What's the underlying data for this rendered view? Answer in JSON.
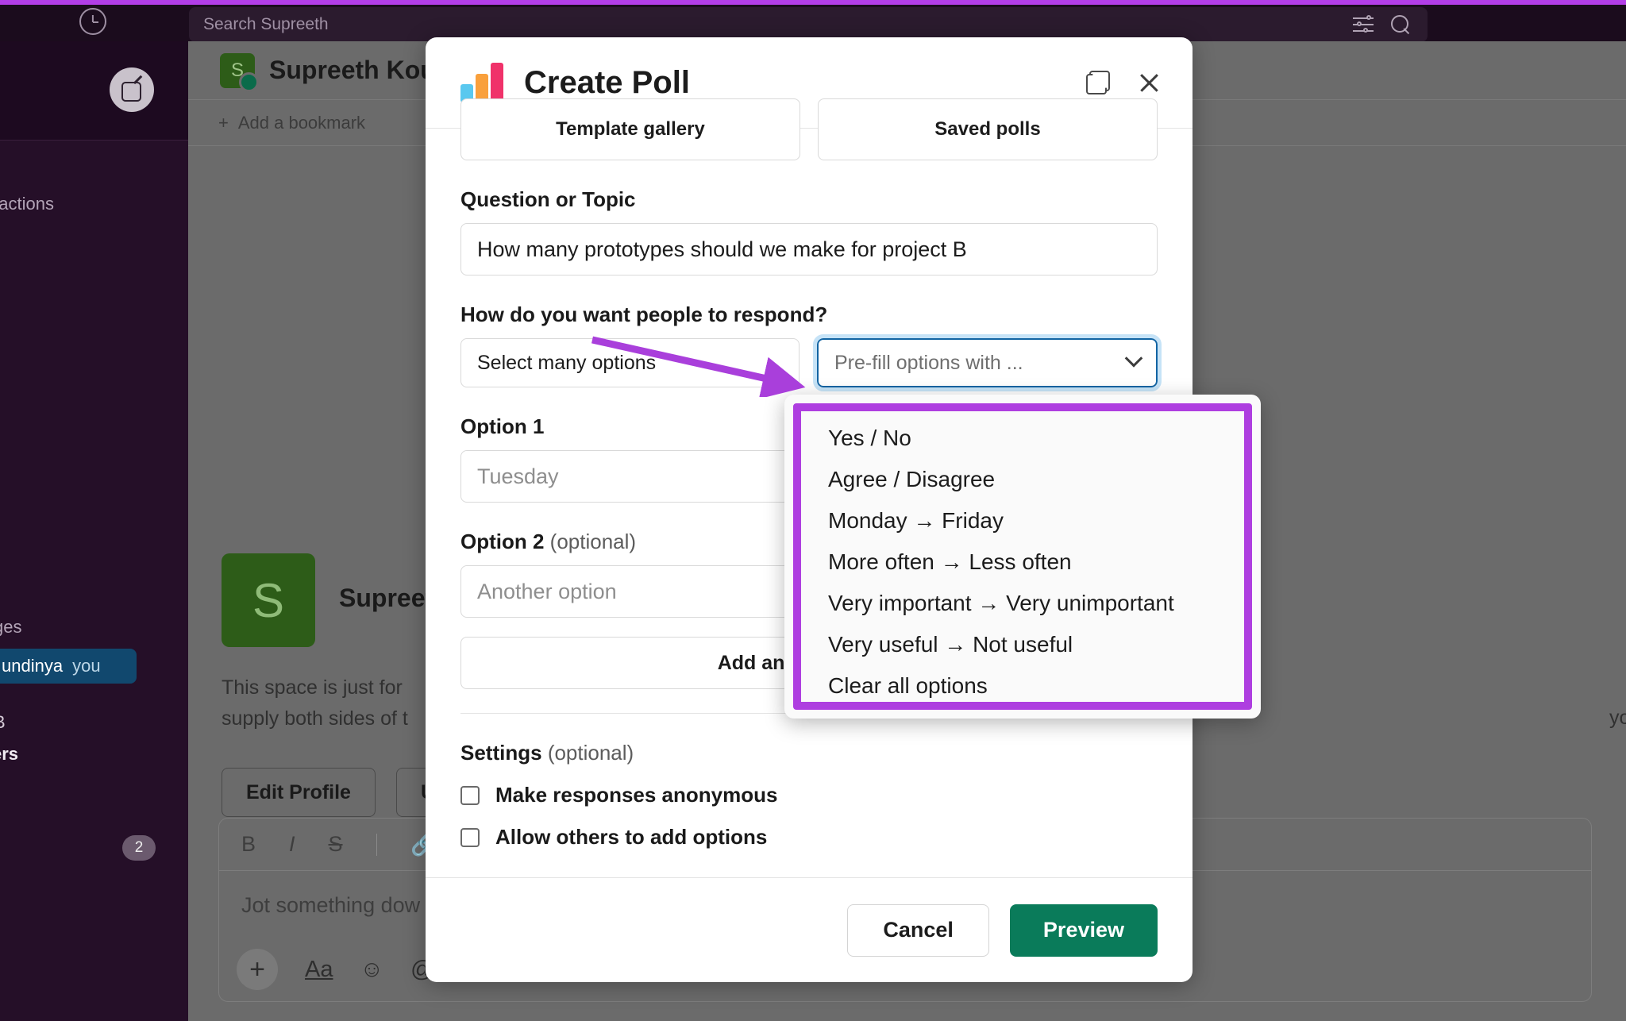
{
  "topbar": {
    "history_icon": "clock-icon",
    "search_placeholder": "Search Supreeth",
    "filter_icon": "sliders-icon",
    "search_icon": "search-icon"
  },
  "sidebar": {
    "compose_icon": "compose-pencil-icon",
    "reactions_label": "eactions",
    "messages_label": "ges",
    "selected_dm": {
      "name": "undinya",
      "suffix": "you"
    },
    "item_b": "B",
    "item_ers": "ers",
    "badge_count": "2"
  },
  "main": {
    "header_title": "Supreeth Kou",
    "avatar_initial": "S",
    "bookmark_label": "Add a bookmark",
    "bookmark_plus": "+",
    "profile_name": "Supreeth K",
    "profile_desc_line1": "This space is just for",
    "profile_desc_line2": "supply both sides of t",
    "profile_tail": "yourself here, but please bear in mind",
    "btn_edit_profile": "Edit Profile",
    "btn_up": "Up",
    "composer": {
      "bold": "B",
      "italic": "I",
      "strike": "S",
      "link_icon": "link-icon",
      "placeholder": "Jot something dow",
      "plus_icon": "+",
      "format_icon": "Aa",
      "emoji_icon": "☺",
      "mention_icon": "@"
    }
  },
  "modal": {
    "title": "Create Poll",
    "logo_icon": "poll-bar-chart-icon",
    "copy_icon": "duplicate-icon",
    "close_icon": "close-icon",
    "template_gallery": "Template gallery",
    "saved_polls": "Saved polls",
    "question_label": "Question or Topic",
    "question_value": "How many prototypes should we make for project B",
    "respond_label": "How do you want people to respond?",
    "respond_type": "Select many options",
    "prefill_label": "Pre-fill options with ...",
    "option1_label": "Option 1",
    "option1_placeholder": "Tuesday",
    "option2_label": "Option 2",
    "option2_optional": "(optional)",
    "option2_placeholder": "Another option",
    "add_another_option": "Add another option",
    "settings_label": "Settings",
    "settings_optional": "(optional)",
    "checkbox_anonymous": "Make responses anonymous",
    "checkbox_add_options": "Allow others to add options",
    "cancel": "Cancel",
    "preview": "Preview"
  },
  "dropdown": {
    "items": [
      "Yes / No",
      "Agree / Disagree",
      "Monday → Friday",
      "More often → Less often",
      "Very important → Very unimportant",
      "Very useful → Not useful",
      "Clear all options"
    ]
  },
  "annotation": {
    "arrow_color": "#a93fdb",
    "highlight_color": "#ae3ee0"
  },
  "colors": {
    "accent_purple": "#b33ee8",
    "preview_green": "#0a7b5a",
    "focus_blue": "#1264a3",
    "poll_bar_blue": "#5ac8ef",
    "poll_bar_orange": "#f9a03c",
    "poll_bar_pink": "#f0326a"
  }
}
